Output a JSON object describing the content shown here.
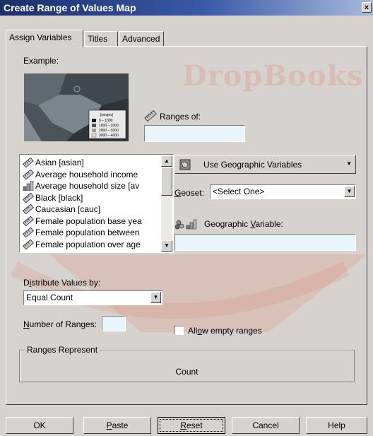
{
  "window": {
    "title": "Create Range of Values Map",
    "close_label": "×"
  },
  "tabs": [
    {
      "label": "Assign Variables"
    },
    {
      "label": "Titles"
    },
    {
      "label": "Advanced"
    }
  ],
  "example": {
    "label": "Example:",
    "legend": [
      "0 – 1000",
      "1000 – 2000",
      "2000 – 3000",
      "3000 – 4000"
    ],
    "legend_title": "[ranges]"
  },
  "ranges_of": {
    "label": "Ranges of:",
    "value": ""
  },
  "variables": [
    {
      "label": "Asian [asian]",
      "icon": "ruler-icon"
    },
    {
      "label": "Average household income",
      "icon": "ruler-icon"
    },
    {
      "label": "Average household size [av",
      "icon": "bar-chart-icon"
    },
    {
      "label": "Black [black]",
      "icon": "ruler-icon"
    },
    {
      "label": "Caucasian [cauc]",
      "icon": "ruler-icon"
    },
    {
      "label": "Female population base yea",
      "icon": "ruler-icon"
    },
    {
      "label": "Female population between",
      "icon": "ruler-icon"
    },
    {
      "label": "Female population over age",
      "icon": "ruler-icon"
    }
  ],
  "geo_mode": {
    "label": "Use Geographic Variables"
  },
  "geoset": {
    "label": "Geoset:",
    "value": "<Select One>"
  },
  "geo_variable": {
    "label": "Geographic Variable:",
    "value": ""
  },
  "distribute": {
    "label": "Distribute Values by:",
    "value": "Equal Count"
  },
  "number_of_ranges": {
    "label": "Number of Ranges:",
    "value": ""
  },
  "allow_empty": {
    "label": "Allow empty ranges",
    "checked": false
  },
  "ranges_represent": {
    "legend": "Ranges Represent",
    "value": "Count"
  },
  "buttons": {
    "ok": "OK",
    "paste": "Paste",
    "reset": "Reset",
    "cancel": "Cancel",
    "help": "Help"
  },
  "watermark": {
    "text": "DropBooks"
  },
  "colors": {
    "title_start": "#1b2f6b",
    "title_end": "#a7b9dc",
    "field_bg": "#e8f6fa",
    "watermark": "#e07060"
  }
}
